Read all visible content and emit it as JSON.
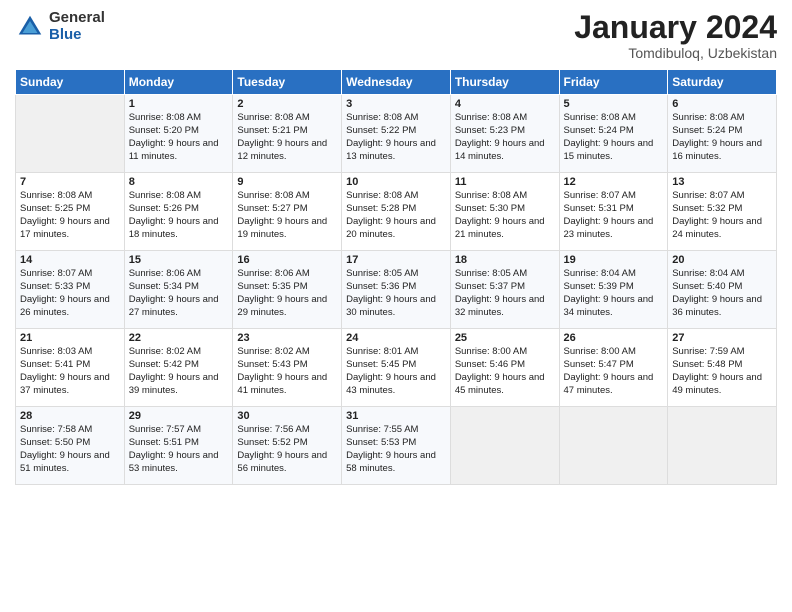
{
  "header": {
    "logo_general": "General",
    "logo_blue": "Blue",
    "month_title": "January 2024",
    "location": "Tomdibuloq, Uzbekistan"
  },
  "days_of_week": [
    "Sunday",
    "Monday",
    "Tuesday",
    "Wednesday",
    "Thursday",
    "Friday",
    "Saturday"
  ],
  "weeks": [
    [
      {
        "day": "",
        "sunrise": "",
        "sunset": "",
        "daylight": ""
      },
      {
        "day": "1",
        "sunrise": "Sunrise: 8:08 AM",
        "sunset": "Sunset: 5:20 PM",
        "daylight": "Daylight: 9 hours and 11 minutes."
      },
      {
        "day": "2",
        "sunrise": "Sunrise: 8:08 AM",
        "sunset": "Sunset: 5:21 PM",
        "daylight": "Daylight: 9 hours and 12 minutes."
      },
      {
        "day": "3",
        "sunrise": "Sunrise: 8:08 AM",
        "sunset": "Sunset: 5:22 PM",
        "daylight": "Daylight: 9 hours and 13 minutes."
      },
      {
        "day": "4",
        "sunrise": "Sunrise: 8:08 AM",
        "sunset": "Sunset: 5:23 PM",
        "daylight": "Daylight: 9 hours and 14 minutes."
      },
      {
        "day": "5",
        "sunrise": "Sunrise: 8:08 AM",
        "sunset": "Sunset: 5:24 PM",
        "daylight": "Daylight: 9 hours and 15 minutes."
      },
      {
        "day": "6",
        "sunrise": "Sunrise: 8:08 AM",
        "sunset": "Sunset: 5:24 PM",
        "daylight": "Daylight: 9 hours and 16 minutes."
      }
    ],
    [
      {
        "day": "7",
        "sunrise": "Sunrise: 8:08 AM",
        "sunset": "Sunset: 5:25 PM",
        "daylight": "Daylight: 9 hours and 17 minutes."
      },
      {
        "day": "8",
        "sunrise": "Sunrise: 8:08 AM",
        "sunset": "Sunset: 5:26 PM",
        "daylight": "Daylight: 9 hours and 18 minutes."
      },
      {
        "day": "9",
        "sunrise": "Sunrise: 8:08 AM",
        "sunset": "Sunset: 5:27 PM",
        "daylight": "Daylight: 9 hours and 19 minutes."
      },
      {
        "day": "10",
        "sunrise": "Sunrise: 8:08 AM",
        "sunset": "Sunset: 5:28 PM",
        "daylight": "Daylight: 9 hours and 20 minutes."
      },
      {
        "day": "11",
        "sunrise": "Sunrise: 8:08 AM",
        "sunset": "Sunset: 5:30 PM",
        "daylight": "Daylight: 9 hours and 21 minutes."
      },
      {
        "day": "12",
        "sunrise": "Sunrise: 8:07 AM",
        "sunset": "Sunset: 5:31 PM",
        "daylight": "Daylight: 9 hours and 23 minutes."
      },
      {
        "day": "13",
        "sunrise": "Sunrise: 8:07 AM",
        "sunset": "Sunset: 5:32 PM",
        "daylight": "Daylight: 9 hours and 24 minutes."
      }
    ],
    [
      {
        "day": "14",
        "sunrise": "Sunrise: 8:07 AM",
        "sunset": "Sunset: 5:33 PM",
        "daylight": "Daylight: 9 hours and 26 minutes."
      },
      {
        "day": "15",
        "sunrise": "Sunrise: 8:06 AM",
        "sunset": "Sunset: 5:34 PM",
        "daylight": "Daylight: 9 hours and 27 minutes."
      },
      {
        "day": "16",
        "sunrise": "Sunrise: 8:06 AM",
        "sunset": "Sunset: 5:35 PM",
        "daylight": "Daylight: 9 hours and 29 minutes."
      },
      {
        "day": "17",
        "sunrise": "Sunrise: 8:05 AM",
        "sunset": "Sunset: 5:36 PM",
        "daylight": "Daylight: 9 hours and 30 minutes."
      },
      {
        "day": "18",
        "sunrise": "Sunrise: 8:05 AM",
        "sunset": "Sunset: 5:37 PM",
        "daylight": "Daylight: 9 hours and 32 minutes."
      },
      {
        "day": "19",
        "sunrise": "Sunrise: 8:04 AM",
        "sunset": "Sunset: 5:39 PM",
        "daylight": "Daylight: 9 hours and 34 minutes."
      },
      {
        "day": "20",
        "sunrise": "Sunrise: 8:04 AM",
        "sunset": "Sunset: 5:40 PM",
        "daylight": "Daylight: 9 hours and 36 minutes."
      }
    ],
    [
      {
        "day": "21",
        "sunrise": "Sunrise: 8:03 AM",
        "sunset": "Sunset: 5:41 PM",
        "daylight": "Daylight: 9 hours and 37 minutes."
      },
      {
        "day": "22",
        "sunrise": "Sunrise: 8:02 AM",
        "sunset": "Sunset: 5:42 PM",
        "daylight": "Daylight: 9 hours and 39 minutes."
      },
      {
        "day": "23",
        "sunrise": "Sunrise: 8:02 AM",
        "sunset": "Sunset: 5:43 PM",
        "daylight": "Daylight: 9 hours and 41 minutes."
      },
      {
        "day": "24",
        "sunrise": "Sunrise: 8:01 AM",
        "sunset": "Sunset: 5:45 PM",
        "daylight": "Daylight: 9 hours and 43 minutes."
      },
      {
        "day": "25",
        "sunrise": "Sunrise: 8:00 AM",
        "sunset": "Sunset: 5:46 PM",
        "daylight": "Daylight: 9 hours and 45 minutes."
      },
      {
        "day": "26",
        "sunrise": "Sunrise: 8:00 AM",
        "sunset": "Sunset: 5:47 PM",
        "daylight": "Daylight: 9 hours and 47 minutes."
      },
      {
        "day": "27",
        "sunrise": "Sunrise: 7:59 AM",
        "sunset": "Sunset: 5:48 PM",
        "daylight": "Daylight: 9 hours and 49 minutes."
      }
    ],
    [
      {
        "day": "28",
        "sunrise": "Sunrise: 7:58 AM",
        "sunset": "Sunset: 5:50 PM",
        "daylight": "Daylight: 9 hours and 51 minutes."
      },
      {
        "day": "29",
        "sunrise": "Sunrise: 7:57 AM",
        "sunset": "Sunset: 5:51 PM",
        "daylight": "Daylight: 9 hours and 53 minutes."
      },
      {
        "day": "30",
        "sunrise": "Sunrise: 7:56 AM",
        "sunset": "Sunset: 5:52 PM",
        "daylight": "Daylight: 9 hours and 56 minutes."
      },
      {
        "day": "31",
        "sunrise": "Sunrise: 7:55 AM",
        "sunset": "Sunset: 5:53 PM",
        "daylight": "Daylight: 9 hours and 58 minutes."
      },
      {
        "day": "",
        "sunrise": "",
        "sunset": "",
        "daylight": ""
      },
      {
        "day": "",
        "sunrise": "",
        "sunset": "",
        "daylight": ""
      },
      {
        "day": "",
        "sunrise": "",
        "sunset": "",
        "daylight": ""
      }
    ]
  ]
}
